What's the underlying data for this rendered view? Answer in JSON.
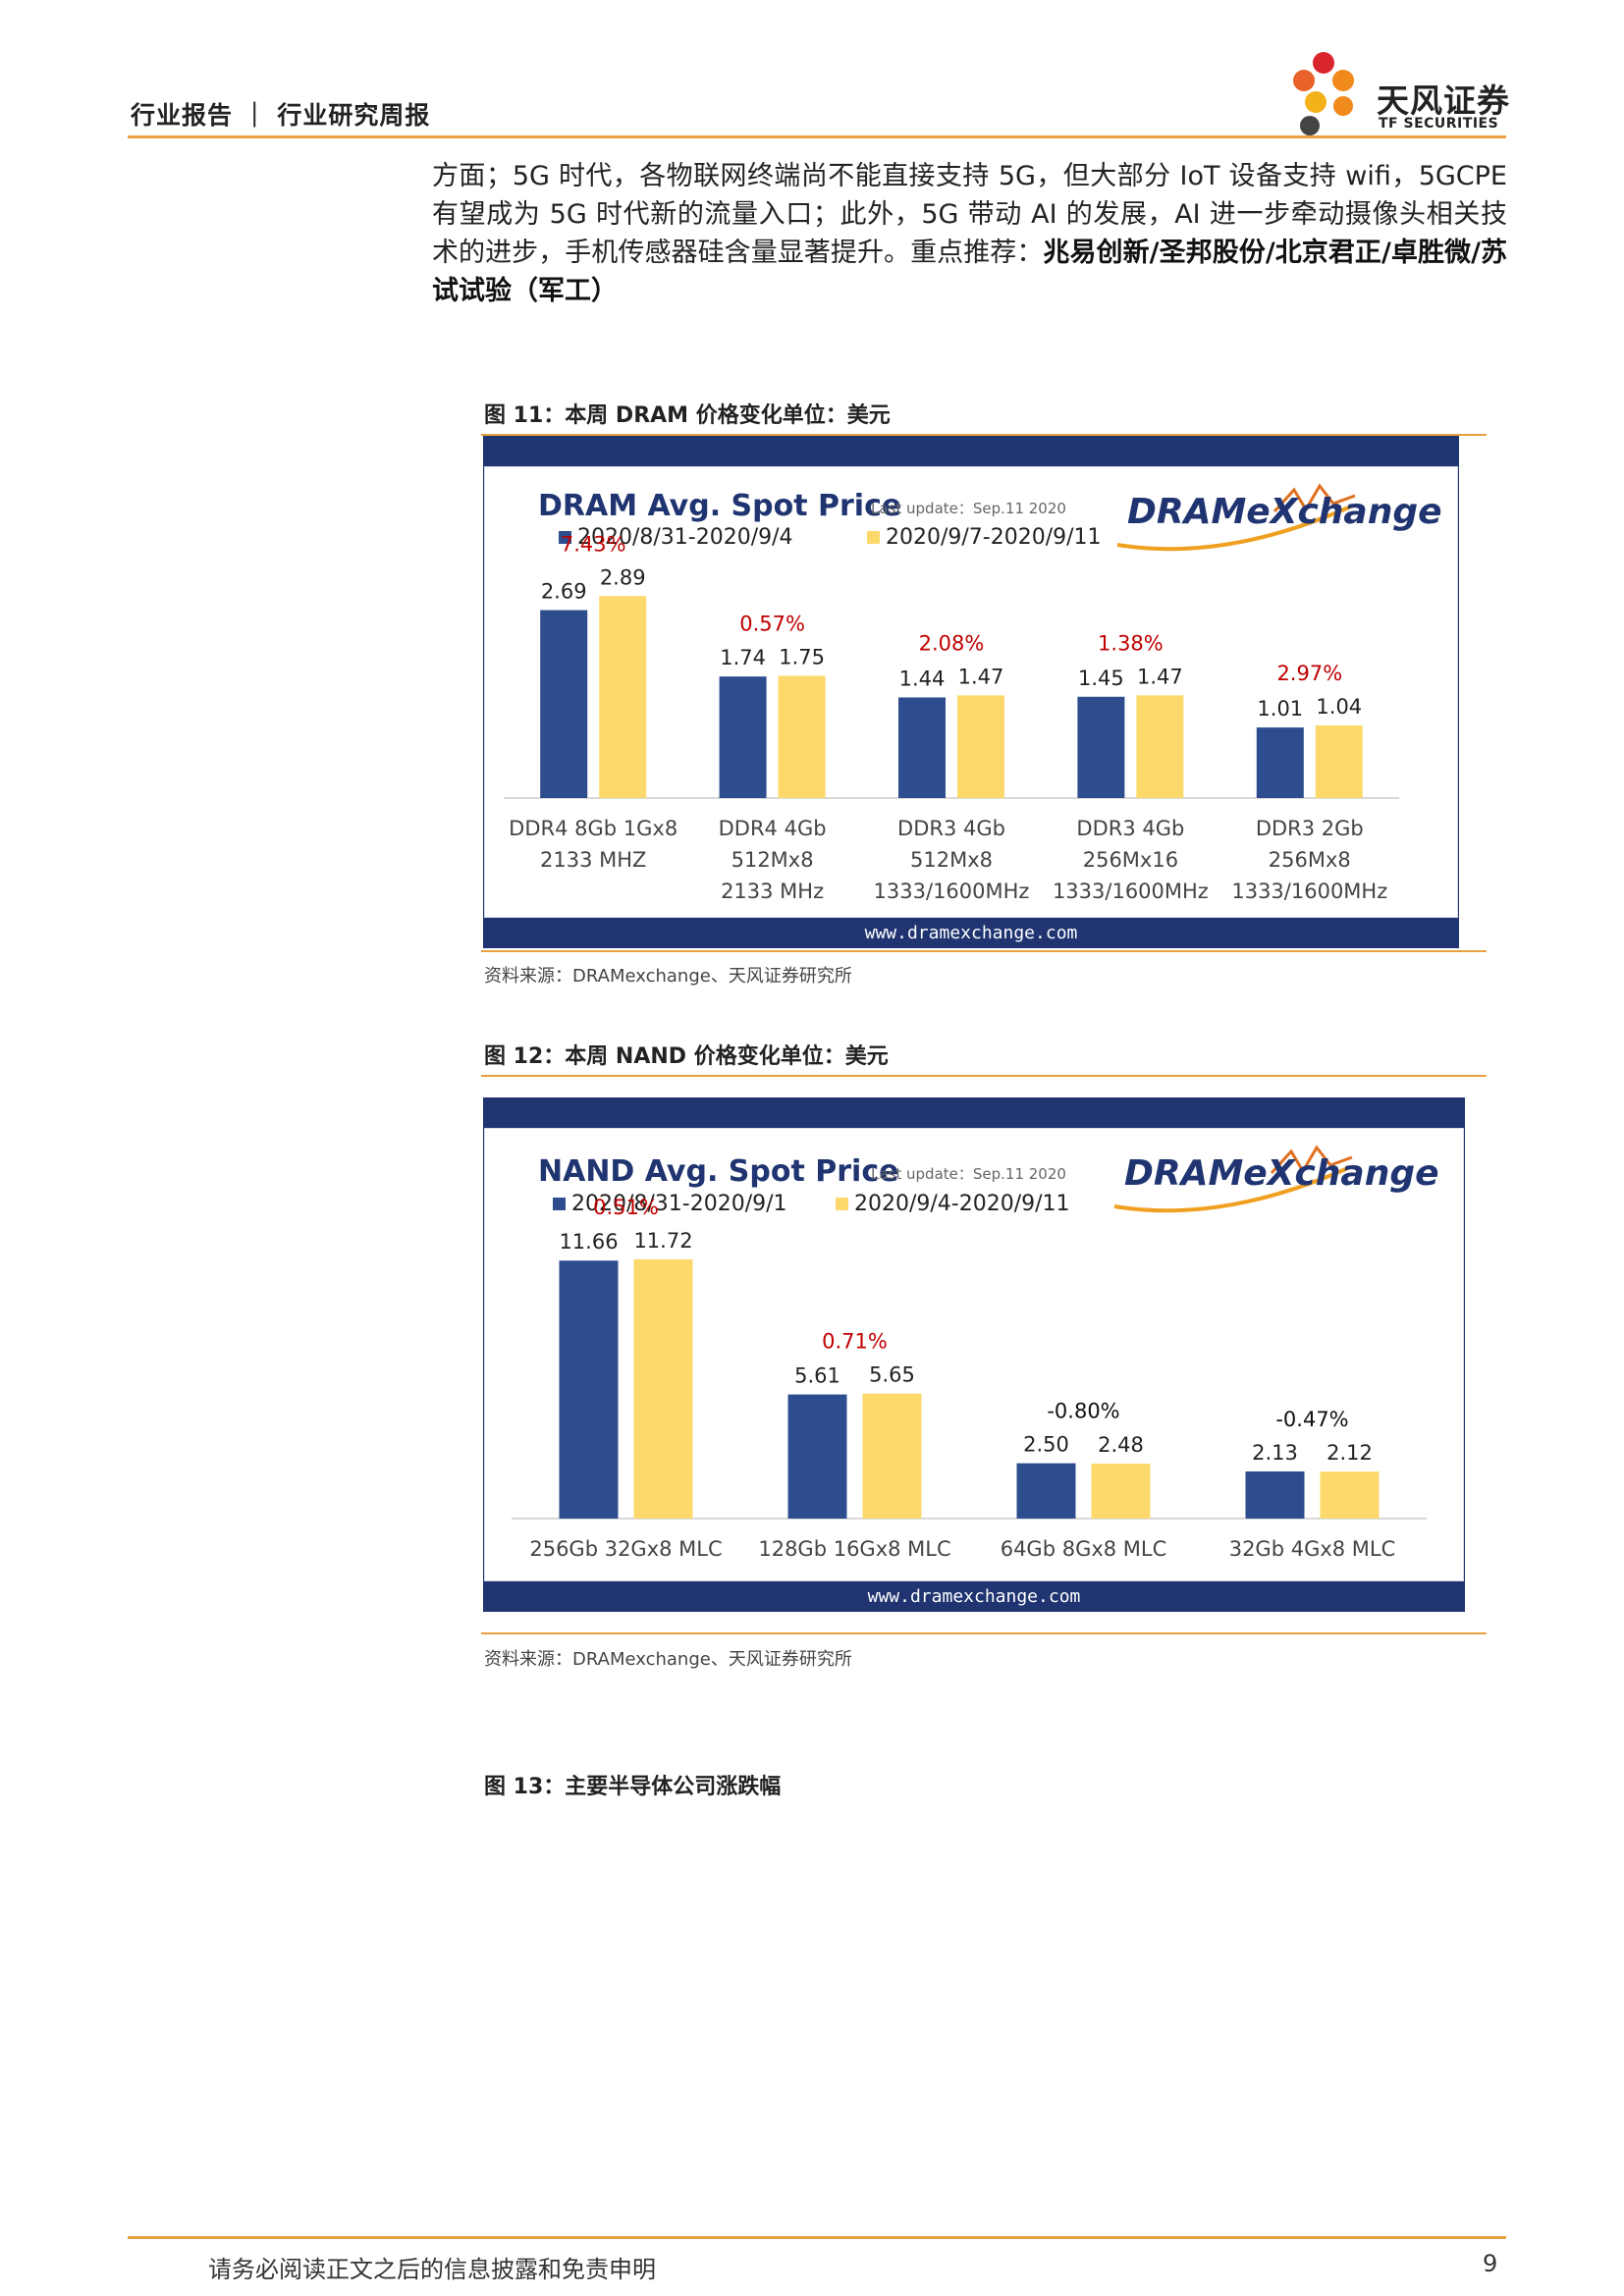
{
  "header": {
    "left_text": "行业报告 ｜ 行业研究周报",
    "logo_cn": "天风证券",
    "logo_en": "TF SECURITIES"
  },
  "paragraph": {
    "text_1": "方面；5G 时代，各物联网终端尚不能直接支持 5G，但大部分 IoT 设备支持 wifi，5GCPE 有望成为 5G 时代新的流量入口；此外，5G 带动 AI 的发展，AI 进一步牵动摄像头相关技术的进步，手机传感器硅含量显著提升。重点推荐：",
    "text_bold": "兆易创新/圣邦股份/北京君正/卓胜微/苏试试验（军工）"
  },
  "figures": {
    "fig11": {
      "caption": "图 11：本周 DRAM 价格变化单位：美元",
      "source": "资料来源：DRAMexchange、天风证券研究所"
    },
    "fig12": {
      "caption": "图 12：本周 NAND 价格变化单位：美元",
      "source": "资料来源：DRAMexchange、天风证券研究所"
    },
    "fig13": {
      "caption": "图 13：主要半导体公司涨跌幅"
    }
  },
  "chart_data": [
    {
      "type": "bar",
      "title": "DRAM Avg. Spot Price",
      "subtitle": "Last update：Sep.11 2020",
      "brand": "DRAMeXchange",
      "footer_url": "www.dramexchange.com",
      "legend_position": "top-left",
      "categories": [
        [
          "DDR4 8Gb 1Gx8",
          "2133 MHZ"
        ],
        [
          "DDR4 4Gb",
          "512Mx8",
          "2133 MHz"
        ],
        [
          "DDR3 4Gb",
          "512Mx8",
          "1333/1600MHz"
        ],
        [
          "DDR3 4Gb",
          "256Mx16",
          "1333/1600MHz"
        ],
        [
          "DDR3 2Gb",
          "256Mx8",
          "1333/1600MHz"
        ]
      ],
      "series": [
        {
          "name": "2020/8/31-2020/9/4",
          "color": "#2e4d8f",
          "values": [
            2.69,
            1.74,
            1.44,
            1.45,
            1.01
          ],
          "labels": [
            "2.69",
            "1.74",
            "1.44",
            "1.45",
            "1.01"
          ]
        },
        {
          "name": "2020/9/7-2020/9/11",
          "color": "#fcd96a",
          "values": [
            2.89,
            1.75,
            1.47,
            1.47,
            1.04
          ],
          "labels": [
            "2.89",
            "1.75",
            "1.47",
            "1.47",
            "1.04"
          ]
        }
      ],
      "changes": [
        "7.43%",
        "0.57%",
        "2.08%",
        "1.38%",
        "2.97%"
      ],
      "change_colors": [
        "#c00000",
        "#c00000",
        "#c00000",
        "#c00000",
        "#c00000"
      ],
      "ylim": [
        0,
        3.4
      ],
      "grid": false
    },
    {
      "type": "bar",
      "title": "NAND Avg. Spot Price",
      "subtitle": "Last update：Sep.11 2020",
      "brand": "DRAMeXchange",
      "footer_url": "www.dramexchange.com",
      "legend_position": "top-left",
      "categories": [
        [
          "256Gb 32Gx8 MLC"
        ],
        [
          "128Gb 16Gx8 MLC"
        ],
        [
          "64Gb 8Gx8 MLC"
        ],
        [
          "32Gb 4Gx8 MLC"
        ]
      ],
      "series": [
        {
          "name": "2020/8/31-2020/9/1",
          "color": "#2e4d8f",
          "values": [
            11.66,
            5.61,
            2.5,
            2.13
          ],
          "labels": [
            "11.66",
            "5.61",
            "2.50",
            "2.13"
          ]
        },
        {
          "name": "2020/9/4-2020/9/11",
          "color": "#fcd96a",
          "values": [
            11.72,
            5.65,
            2.48,
            2.12
          ],
          "labels": [
            "11.72",
            "5.65",
            "2.48",
            "2.12"
          ]
        }
      ],
      "changes": [
        "0.51%",
        "0.71%",
        "-0.80%",
        "-0.47%"
      ],
      "change_colors": [
        "#c00000",
        "#c00000",
        "#111111",
        "#111111"
      ],
      "ylim": [
        0,
        14.2
      ],
      "grid": false
    }
  ],
  "footer": {
    "disclaimer": "请务必阅读正文之后的信息披露和免责申明",
    "page": "9"
  }
}
